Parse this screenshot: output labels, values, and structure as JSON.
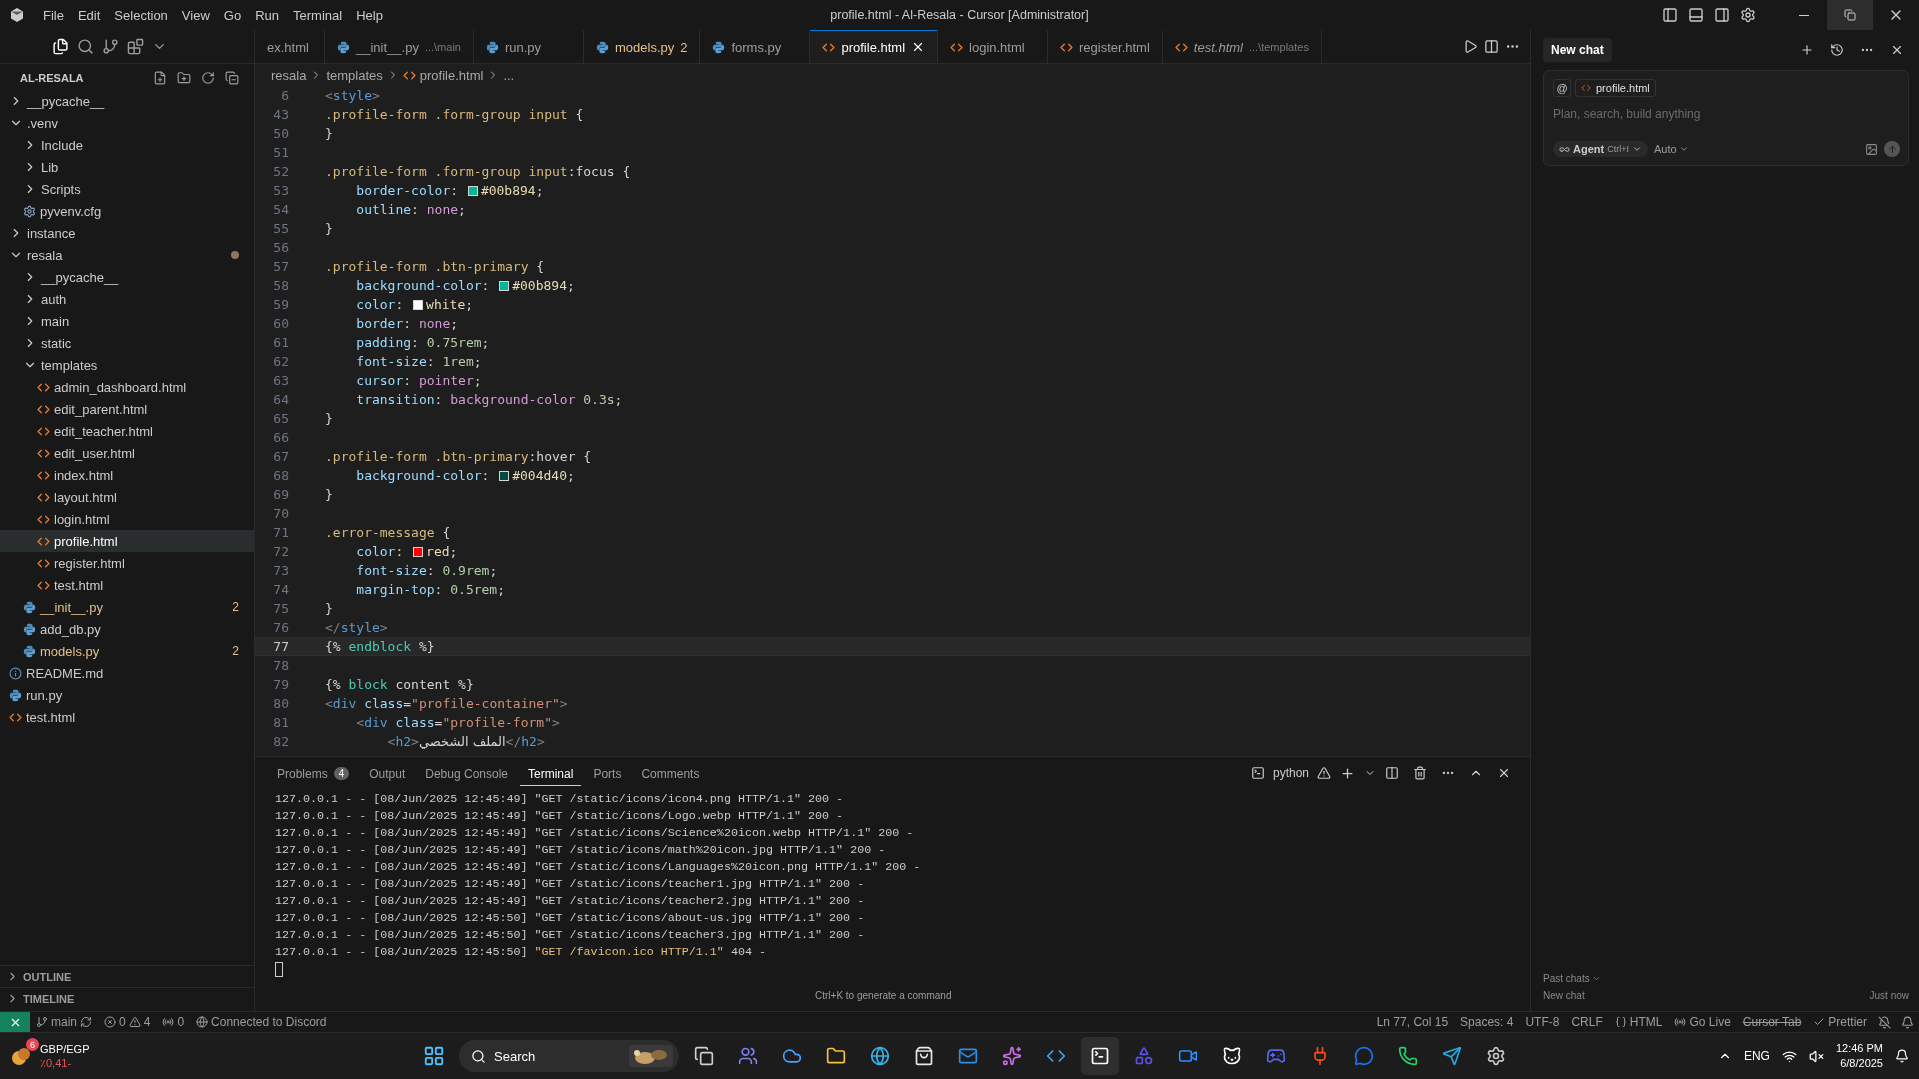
{
  "window": {
    "title": "profile.html - Al-Resala - Cursor [Administrator]"
  },
  "menu": [
    "File",
    "Edit",
    "Selection",
    "View",
    "Go",
    "Run",
    "Terminal",
    "Help"
  ],
  "tabs": [
    {
      "kind": "cut",
      "label": "ex.html",
      "selected": false,
      "preview": false
    },
    {
      "kind": "py",
      "label": "__init__.py",
      "hint": "...\\main",
      "selected": false,
      "preview": false
    },
    {
      "kind": "py",
      "label": "run.py",
      "selected": false,
      "preview": false
    },
    {
      "kind": "py",
      "label": "models.py",
      "problems": "2",
      "selected": false,
      "preview": false
    },
    {
      "kind": "py",
      "label": "forms.py",
      "selected": false,
      "preview": false
    },
    {
      "kind": "html",
      "label": "profile.html",
      "selected": true,
      "preview": false
    },
    {
      "kind": "html",
      "label": "login.html",
      "selected": false,
      "preview": false
    },
    {
      "kind": "html",
      "label": "register.html",
      "selected": false,
      "preview": false
    },
    {
      "kind": "html",
      "label": "test.html",
      "hint": "...\\templates",
      "selected": false,
      "preview": true
    }
  ],
  "explorer": {
    "title": "AL-RESALA",
    "items": [
      {
        "kind": "folder",
        "label": "__pycache__",
        "expanded": false,
        "modified": false,
        "selected": false
      },
      {
        "kind": "folder",
        "label": ".venv",
        "expanded": true,
        "modified": false,
        "selected": false,
        "children": [
          {
            "kind": "folder",
            "label": "Include",
            "expanded": false,
            "modified": false,
            "selected": false
          },
          {
            "kind": "folder",
            "label": "Lib",
            "expanded": false,
            "modified": false,
            "selected": false
          },
          {
            "kind": "folder",
            "label": "Scripts",
            "expanded": false,
            "modified": false,
            "selected": false
          },
          {
            "kind": "cfg",
            "label": "pyvenv.cfg",
            "selected": false
          }
        ]
      },
      {
        "kind": "folder",
        "label": "instance",
        "expanded": false,
        "modified": false,
        "selected": false
      },
      {
        "kind": "folder",
        "label": "resala",
        "expanded": true,
        "modified": true,
        "selected": false,
        "children": [
          {
            "kind": "folder",
            "label": "__pycache__",
            "expanded": false,
            "modified": false,
            "selected": false
          },
          {
            "kind": "folder",
            "label": "auth",
            "expanded": false,
            "modified": false,
            "selected": false
          },
          {
            "kind": "folder",
            "label": "main",
            "expanded": false,
            "modified": false,
            "selected": false
          },
          {
            "kind": "folder",
            "label": "static",
            "expanded": false,
            "modified": false,
            "selected": false
          },
          {
            "kind": "folder",
            "label": "templates",
            "expanded": true,
            "modified": false,
            "selected": false,
            "children": [
              {
                "kind": "html",
                "label": "admin_dashboard.html",
                "selected": false
              },
              {
                "kind": "html",
                "label": "edit_parent.html",
                "selected": false
              },
              {
                "kind": "html",
                "label": "edit_teacher.html",
                "selected": false
              },
              {
                "kind": "html",
                "label": "edit_user.html",
                "selected": false
              },
              {
                "kind": "html",
                "label": "index.html",
                "selected": false
              },
              {
                "kind": "html",
                "label": "layout.html",
                "selected": false
              },
              {
                "kind": "html",
                "label": "login.html",
                "selected": false
              },
              {
                "kind": "html",
                "label": "profile.html",
                "selected": true
              },
              {
                "kind": "html",
                "label": "register.html",
                "selected": false
              },
              {
                "kind": "html",
                "label": "test.html",
                "selected": false
              }
            ]
          },
          {
            "kind": "py",
            "label": "__init__.py",
            "problems": "2",
            "selected": false
          },
          {
            "kind": "py",
            "label": "add_db.py",
            "selected": false
          },
          {
            "kind": "py",
            "label": "models.py",
            "problems": "2",
            "selected": false
          }
        ]
      },
      {
        "kind": "md",
        "label": "README.md",
        "selected": false
      },
      {
        "kind": "py",
        "label": "run.py",
        "selected": false
      },
      {
        "kind": "html",
        "label": "test.html",
        "selected": false
      }
    ]
  },
  "outline": [
    "OUTLINE",
    "TIMELINE"
  ],
  "breadcrumb": [
    "resala",
    "templates",
    "profile.html",
    "..."
  ],
  "code": {
    "lines": [
      {
        "number": "6",
        "current": false,
        "tokens": [
          {
            "kind": "angle",
            "text": "<"
          },
          {
            "kind": "tag",
            "text": "style"
          },
          {
            "kind": "angle",
            "text": ">"
          }
        ]
      },
      {
        "number": "43",
        "current": false,
        "tokens": [
          {
            "kind": "sel",
            "text": ".profile-form .form-group input"
          },
          {
            "kind": "brace",
            "text": " {"
          }
        ]
      },
      {
        "number": "50",
        "current": false,
        "tokens": [
          {
            "kind": "brace",
            "text": "}"
          }
        ]
      },
      {
        "number": "51",
        "current": false
      },
      {
        "number": "52",
        "current": false,
        "tokens": [
          {
            "kind": "sel",
            "text": ".profile-form .form-group input"
          },
          {
            "kind": "brace",
            "text": ":focus {"
          }
        ]
      },
      {
        "number": "53",
        "current": false,
        "tokens": [
          {
            "kind": "prop",
            "text": "    border-color"
          },
          {
            "kind": "brace",
            "text": ": "
          },
          {
            "kind": "swatch",
            "color": "#00b894"
          },
          {
            "kind": "val",
            "text": "#00b894"
          },
          {
            "kind": "brace",
            "text": ";"
          }
        ]
      },
      {
        "number": "54",
        "current": false,
        "tokens": [
          {
            "kind": "prop",
            "text": "    outline"
          },
          {
            "kind": "brace",
            "text": ": "
          },
          {
            "kind": "kw",
            "text": "none"
          },
          {
            "kind": "brace",
            "text": ";"
          }
        ]
      },
      {
        "number": "55",
        "current": false,
        "tokens": [
          {
            "kind": "brace",
            "text": "}"
          }
        ]
      },
      {
        "number": "56",
        "current": false
      },
      {
        "number": "57",
        "current": false,
        "tokens": [
          {
            "kind": "sel",
            "text": ".profile-form .btn-primary"
          },
          {
            "kind": "brace",
            "text": " {"
          }
        ]
      },
      {
        "number": "58",
        "current": false,
        "tokens": [
          {
            "kind": "prop",
            "text": "    background-color"
          },
          {
            "kind": "brace",
            "text": ": "
          },
          {
            "kind": "swatch",
            "color": "#00b894"
          },
          {
            "kind": "val",
            "text": "#00b894"
          },
          {
            "kind": "brace",
            "text": ";"
          }
        ]
      },
      {
        "number": "59",
        "current": false,
        "tokens": [
          {
            "kind": "prop",
            "text": "    color"
          },
          {
            "kind": "brace",
            "text": ": "
          },
          {
            "kind": "swatch",
            "color": "#ffffff"
          },
          {
            "kind": "val",
            "text": "white"
          },
          {
            "kind": "brace",
            "text": ";"
          }
        ]
      },
      {
        "number": "60",
        "current": false,
        "tokens": [
          {
            "kind": "prop",
            "text": "    border"
          },
          {
            "kind": "brace",
            "text": ": "
          },
          {
            "kind": "kw",
            "text": "none"
          },
          {
            "kind": "brace",
            "text": ";"
          }
        ]
      },
      {
        "number": "61",
        "current": false,
        "tokens": [
          {
            "kind": "prop",
            "text": "    padding"
          },
          {
            "kind": "brace",
            "text": ": "
          },
          {
            "kind": "num",
            "text": "0.75rem"
          },
          {
            "kind": "brace",
            "text": ";"
          }
        ]
      },
      {
        "number": "62",
        "current": false,
        "tokens": [
          {
            "kind": "prop",
            "text": "    font-size"
          },
          {
            "kind": "brace",
            "text": ": "
          },
          {
            "kind": "num",
            "text": "1rem"
          },
          {
            "kind": "brace",
            "text": ";"
          }
        ]
      },
      {
        "number": "63",
        "current": false,
        "tokens": [
          {
            "kind": "prop",
            "text": "    cursor"
          },
          {
            "kind": "brace",
            "text": ": "
          },
          {
            "kind": "kw",
            "text": "pointer"
          },
          {
            "kind": "brace",
            "text": ";"
          }
        ]
      },
      {
        "number": "64",
        "current": false,
        "tokens": [
          {
            "kind": "prop",
            "text": "    transition"
          },
          {
            "kind": "brace",
            "text": ": "
          },
          {
            "kind": "kw",
            "text": "background-color"
          },
          {
            "kind": "num",
            "text": " 0.3s"
          },
          {
            "kind": "brace",
            "text": ";"
          }
        ]
      },
      {
        "number": "65",
        "current": false,
        "tokens": [
          {
            "kind": "brace",
            "text": "}"
          }
        ]
      },
      {
        "number": "66",
        "current": false
      },
      {
        "number": "67",
        "current": false,
        "tokens": [
          {
            "kind": "sel",
            "text": ".profile-form .btn-primary"
          },
          {
            "kind": "brace",
            "text": ":hover {"
          }
        ]
      },
      {
        "number": "68",
        "current": false,
        "tokens": [
          {
            "kind": "prop",
            "text": "    background-color"
          },
          {
            "kind": "brace",
            "text": ": "
          },
          {
            "kind": "swatch",
            "color": "#004d40"
          },
          {
            "kind": "val",
            "text": "#004d40"
          },
          {
            "kind": "brace",
            "text": ";"
          }
        ]
      },
      {
        "number": "69",
        "current": false,
        "tokens": [
          {
            "kind": "brace",
            "text": "}"
          }
        ]
      },
      {
        "number": "70",
        "current": false
      },
      {
        "number": "71",
        "current": false,
        "tokens": [
          {
            "kind": "sel",
            "text": ".error-message"
          },
          {
            "kind": "brace",
            "text": " {"
          }
        ]
      },
      {
        "number": "72",
        "current": false,
        "tokens": [
          {
            "kind": "prop",
            "text": "    color"
          },
          {
            "kind": "brace",
            "text": ": "
          },
          {
            "kind": "swatch",
            "color": "#ff0000"
          },
          {
            "kind": "val",
            "text": "red"
          },
          {
            "kind": "brace",
            "text": ";"
          }
        ]
      },
      {
        "number": "73",
        "current": false,
        "tokens": [
          {
            "kind": "prop",
            "text": "    font-size"
          },
          {
            "kind": "brace",
            "text": ": "
          },
          {
            "kind": "num",
            "text": "0.9rem"
          },
          {
            "kind": "brace",
            "text": ";"
          }
        ]
      },
      {
        "number": "74",
        "current": false,
        "tokens": [
          {
            "kind": "prop",
            "text": "    margin-top"
          },
          {
            "kind": "brace",
            "text": ": "
          },
          {
            "kind": "num",
            "text": "0.5rem"
          },
          {
            "kind": "brace",
            "text": ";"
          }
        ]
      },
      {
        "number": "75",
        "current": false,
        "tokens": [
          {
            "kind": "brace",
            "text": "}"
          }
        ]
      },
      {
        "number": "76",
        "current": false,
        "tokens": [
          {
            "kind": "angle",
            "text": "</"
          },
          {
            "kind": "tag",
            "text": "style"
          },
          {
            "kind": "angle",
            "text": ">"
          }
        ]
      },
      {
        "number": "77",
        "current": true,
        "tokens": [
          {
            "kind": "brace",
            "text": "{% "
          },
          {
            "kind": "tmpl",
            "text": "endblock"
          },
          {
            "kind": "brace",
            "text": " %}"
          }
        ]
      },
      {
        "number": "78",
        "current": false
      },
      {
        "number": "79",
        "current": false,
        "tokens": [
          {
            "kind": "brace",
            "text": "{% "
          },
          {
            "kind": "tmpl",
            "text": "block"
          },
          {
            "kind": "brace",
            "text": " content %}"
          }
        ]
      },
      {
        "number": "80",
        "current": false,
        "tokens": [
          {
            "kind": "angle",
            "text": "<"
          },
          {
            "kind": "tag",
            "text": "div"
          },
          {
            "kind": "attr",
            "text": " class"
          },
          {
            "kind": "brace",
            "text": "="
          },
          {
            "kind": "str",
            "text": "\"profile-container\""
          },
          {
            "kind": "angle",
            "text": ">"
          }
        ]
      },
      {
        "number": "81",
        "current": false,
        "tokens": [
          {
            "kind": "angle",
            "text": "    <"
          },
          {
            "kind": "tag",
            "text": "div"
          },
          {
            "kind": "attr",
            "text": " class"
          },
          {
            "kind": "brace",
            "text": "="
          },
          {
            "kind": "str",
            "text": "\"profile-form\""
          },
          {
            "kind": "angle",
            "text": ">"
          }
        ]
      },
      {
        "number": "82",
        "current": false,
        "tokens": [
          {
            "kind": "angle",
            "text": "        <"
          },
          {
            "kind": "tag",
            "text": "h2"
          },
          {
            "kind": "angle",
            "text": ">"
          },
          {
            "kind": "rtl",
            "text": "الملف الشخصي"
          },
          {
            "kind": "angle",
            "text": "</"
          },
          {
            "kind": "tag",
            "text": "h2"
          },
          {
            "kind": "angle",
            "text": ">"
          }
        ]
      }
    ]
  },
  "panel": {
    "tabs": [
      {
        "label": "Problems",
        "badge": "4",
        "selected": false
      },
      {
        "label": "Output",
        "selected": false
      },
      {
        "label": "Debug Console",
        "selected": false
      },
      {
        "label": "Terminal",
        "selected": true
      },
      {
        "label": "Ports",
        "selected": false
      },
      {
        "label": "Comments",
        "selected": false
      }
    ],
    "shell": "python",
    "terminal": [
      {
        "prefix": "127.0.0.1 - - [08/Jun/2025 12:45:49] ",
        "request": "\"GET /static/icons/icon4.png HTTP/1.1\"",
        "status": " 200 -",
        "failed": false
      },
      {
        "prefix": "127.0.0.1 - - [08/Jun/2025 12:45:49] ",
        "request": "\"GET /static/icons/Logo.webp HTTP/1.1\"",
        "status": " 200 -",
        "failed": false
      },
      {
        "prefix": "127.0.0.1 - - [08/Jun/2025 12:45:49] ",
        "request": "\"GET /static/icons/Science%20icon.webp HTTP/1.1\"",
        "status": " 200 -",
        "failed": false
      },
      {
        "prefix": "127.0.0.1 - - [08/Jun/2025 12:45:49] ",
        "request": "\"GET /static/icons/math%20icon.jpg HTTP/1.1\"",
        "status": " 200 -",
        "failed": false
      },
      {
        "prefix": "127.0.0.1 - - [08/Jun/2025 12:45:49] ",
        "request": "\"GET /static/icons/Languages%20icon.png HTTP/1.1\"",
        "status": " 200 -",
        "failed": false
      },
      {
        "prefix": "127.0.0.1 - - [08/Jun/2025 12:45:49] ",
        "request": "\"GET /static/icons/teacher1.jpg HTTP/1.1\"",
        "status": " 200 -",
        "failed": false
      },
      {
        "prefix": "127.0.0.1 - - [08/Jun/2025 12:45:49] ",
        "request": "\"GET /static/icons/teacher2.jpg HTTP/1.1\"",
        "status": " 200 -",
        "failed": false
      },
      {
        "prefix": "127.0.0.1 - - [08/Jun/2025 12:45:50] ",
        "request": "\"GET /static/icons/about-us.jpg HTTP/1.1\"",
        "status": " 200 -",
        "failed": false
      },
      {
        "prefix": "127.0.0.1 - - [08/Jun/2025 12:45:50] ",
        "request": "\"GET /static/icons/teacher3.jpg HTTP/1.1\"",
        "status": " 200 -",
        "failed": false
      },
      {
        "prefix": "127.0.0.1 - - [08/Jun/2025 12:45:50] ",
        "request": "\"GET /favicon.ico HTTP/1.1\"",
        "status": " 404 -",
        "failed": true
      }
    ],
    "hint": "Ctrl+K to generate a command"
  },
  "chat": {
    "title": "New chat",
    "mention": "@",
    "context": "profile.html",
    "placeholder": "Plan, search, build anything",
    "mode": "Agent",
    "shortcut": "Ctrl+I",
    "model": "Auto",
    "past_title": "Past chats",
    "past": [
      {
        "title": "New chat",
        "time": "Just now"
      }
    ]
  },
  "status_bar": {
    "branch": "main",
    "errors": "0",
    "warnings": "4",
    "ports": "0",
    "discord": "Connected to Discord",
    "right": [
      {
        "kind": "text",
        "text": "Ln 77, Col 15"
      },
      {
        "kind": "text",
        "text": "Spaces: 4"
      },
      {
        "kind": "text",
        "text": "UTF-8"
      },
      {
        "kind": "text",
        "text": "CRLF"
      },
      {
        "kind": "lang",
        "text": "HTML"
      },
      {
        "kind": "live",
        "text": "Go Live"
      },
      {
        "kind": "struck",
        "text": "Cursor Tab"
      },
      {
        "kind": "check",
        "text": "Prettier"
      }
    ]
  },
  "taskbar": {
    "ticker": {
      "badge": "6",
      "title": "GBP/EGP",
      "value": "٪0,41-"
    },
    "search": "Search",
    "language": "ENG",
    "time": "12:46 PM",
    "date": "6/8/2025"
  }
}
